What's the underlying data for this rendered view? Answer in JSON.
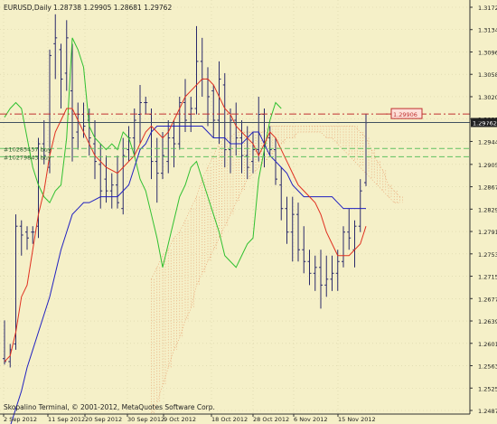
{
  "header": {
    "symbol_timeframe": "EURUSD,Daily",
    "ohlc": "1.28738 1.29905 1.28681 1.29762"
  },
  "footer": {
    "copyright": "Skopalino Terminal, © 2001-2012, MetaQuotes Software Corp."
  },
  "orders": [
    {
      "label": "#10285457 buy",
      "price": 1.2932
    },
    {
      "label": "#10279843 buy",
      "price": 1.2918
    }
  ],
  "price_scale": [
    "1.31720",
    "1.31340",
    "1.30960",
    "1.30580",
    "1.30200",
    "1.29820",
    "1.29440",
    "1.29050",
    "1.28670",
    "1.28290",
    "1.27910",
    "1.27530",
    "1.27150",
    "1.26770",
    "1.26390",
    "1.26010",
    "1.25630",
    "1.25250",
    "1.24870"
  ],
  "markers": {
    "alert_price": "1.29906",
    "current_price": "1.29762"
  },
  "date_labels": [
    "2 Sep 2012",
    "11 Sep 2012",
    "20 Sep 2012",
    "30 Sep 2012",
    "9 Oct 2012",
    "18 Oct 2012",
    "28 Oct 2012",
    "6 Nov 2012",
    "15 Nov 2012"
  ],
  "colors": {
    "background": "#f5f0c8",
    "bars": "#2a2a6a",
    "tenkan": "#e03020",
    "kijun": "#2020c0",
    "chikou": "#30c030",
    "cloud": "#e8a070",
    "order_line": "#60c060",
    "alert_line": "#c03030",
    "current_line": "#405060"
  },
  "chart_data": {
    "type": "ohlc",
    "title": "EURUSD,Daily",
    "ylim": [
      1.2487,
      1.3172
    ],
    "bars": [
      [
        1.2575,
        1.264,
        1.2565,
        1.257
      ],
      [
        1.257,
        1.26,
        1.256,
        1.259
      ],
      [
        1.26,
        1.282,
        1.259,
        1.28
      ],
      [
        1.28,
        1.281,
        1.275,
        1.2785
      ],
      [
        1.279,
        1.28,
        1.276,
        1.278
      ],
      [
        1.279,
        1.28,
        1.277,
        1.279
      ],
      [
        1.28,
        1.295,
        1.278,
        1.294
      ],
      [
        1.294,
        1.298,
        1.2905,
        1.292
      ],
      [
        1.29,
        1.31,
        1.289,
        1.309
      ],
      [
        1.311,
        1.316,
        1.305,
        1.312
      ],
      [
        1.31,
        1.311,
        1.3,
        1.305
      ],
      [
        1.306,
        1.315,
        1.303,
        1.312
      ],
      [
        1.303,
        1.311,
        1.291,
        1.295
      ],
      [
        1.296,
        1.301,
        1.293,
        1.299
      ],
      [
        1.299,
        1.301,
        1.295,
        1.297
      ],
      [
        1.298,
        1.3,
        1.292,
        1.295
      ],
      [
        1.294,
        1.298,
        1.288,
        1.291
      ],
      [
        1.2905,
        1.294,
        1.283,
        1.286
      ],
      [
        1.288,
        1.292,
        1.284,
        1.286
      ],
      [
        1.286,
        1.289,
        1.283,
        1.287
      ],
      [
        1.287,
        1.292,
        1.283,
        1.284
      ],
      [
        1.283,
        1.295,
        1.282,
        1.292
      ],
      [
        1.293,
        1.297,
        1.291,
        1.295
      ],
      [
        1.295,
        1.3,
        1.292,
        1.298
      ],
      [
        1.299,
        1.304,
        1.294,
        1.301
      ],
      [
        1.301,
        1.302,
        1.299,
        1.301
      ],
      [
        1.299,
        1.3,
        1.288,
        1.291
      ],
      [
        1.291,
        1.295,
        1.284,
        1.289
      ],
      [
        1.289,
        1.296,
        1.288,
        1.292
      ],
      [
        1.291,
        1.298,
        1.289,
        1.295
      ],
      [
        1.295,
        1.298,
        1.29,
        1.294
      ],
      [
        1.294,
        1.302,
        1.293,
        1.301
      ],
      [
        1.301,
        1.305,
        1.296,
        1.298
      ],
      [
        1.299,
        1.302,
        1.296,
        1.3
      ],
      [
        1.3,
        1.314,
        1.299,
        1.308
      ],
      [
        1.308,
        1.312,
        1.302,
        1.305
      ],
      [
        1.305,
        1.307,
        1.297,
        1.302
      ],
      [
        1.303,
        1.304,
        1.295,
        1.298
      ],
      [
        1.298,
        1.308,
        1.294,
        1.305
      ],
      [
        1.304,
        1.306,
        1.29,
        1.293
      ],
      [
        1.293,
        1.3,
        1.289,
        1.298
      ],
      [
        1.298,
        1.301,
        1.292,
        1.295
      ],
      [
        1.295,
        1.298,
        1.289,
        1.292
      ],
      [
        1.292,
        1.297,
        1.288,
        1.29
      ],
      [
        1.291,
        1.296,
        1.289,
        1.293
      ],
      [
        1.293,
        1.302,
        1.291,
        1.299
      ],
      [
        1.299,
        1.3,
        1.29,
        1.294
      ],
      [
        1.295,
        1.297,
        1.292,
        1.293
      ],
      [
        1.293,
        1.295,
        1.287,
        1.288
      ],
      [
        1.287,
        1.29,
        1.281,
        1.283
      ],
      [
        1.283,
        1.285,
        1.277,
        1.279
      ],
      [
        1.279,
        1.285,
        1.274,
        1.282
      ],
      [
        1.282,
        1.284,
        1.274,
        1.276
      ],
      [
        1.276,
        1.28,
        1.272,
        1.274
      ],
      [
        1.274,
        1.276,
        1.27,
        1.272
      ],
      [
        1.272,
        1.275,
        1.269,
        1.273
      ],
      [
        1.273,
        1.276,
        1.266,
        1.27
      ],
      [
        1.27,
        1.275,
        1.268,
        1.271
      ],
      [
        1.271,
        1.275,
        1.269,
        1.272
      ],
      [
        1.272,
        1.276,
        1.269,
        1.274
      ],
      [
        1.274,
        1.28,
        1.273,
        1.279
      ],
      [
        1.279,
        1.283,
        1.276,
        1.278
      ],
      [
        1.276,
        1.281,
        1.273,
        1.28
      ],
      [
        1.28,
        1.288,
        1.279,
        1.286
      ],
      [
        1.2874,
        1.2991,
        1.2868,
        1.2976
      ]
    ],
    "cloud_start_bar": 26,
    "senkou_a": [
      1.271,
      1.273,
      1.275,
      1.276,
      1.278,
      1.279,
      1.281,
      1.283,
      1.285,
      1.288,
      1.29,
      1.292,
      1.294,
      1.295,
      1.295,
      1.296,
      1.296,
      1.296,
      1.296,
      1.296,
      1.296,
      1.297,
      1.297,
      1.297,
      1.297,
      1.297,
      1.297,
      1.297,
      1.297,
      1.297,
      1.297,
      1.297,
      1.297,
      1.297,
      1.297,
      1.297,
      1.297,
      1.296,
      1.295,
      1.293,
      1.291,
      1.2895,
      1.287,
      1.286,
      1.285
    ],
    "senkou_b": [
      1.248,
      1.25,
      1.253,
      1.256,
      1.259,
      1.261,
      1.264,
      1.266,
      1.27,
      1.272,
      1.274,
      1.276,
      1.278,
      1.28,
      1.282,
      1.284,
      1.286,
      1.288,
      1.289,
      1.29,
      1.291,
      1.292,
      1.293,
      1.294,
      1.295,
      1.295,
      1.296,
      1.296,
      1.296,
      1.296,
      1.296,
      1.295,
      1.295,
      1.294,
      1.293,
      1.292,
      1.291,
      1.29,
      1.289,
      1.288,
      1.287,
      1.286,
      1.285,
      1.284,
      1.284
    ],
    "tenkan": [
      1.257,
      1.258,
      1.262,
      1.268,
      1.27,
      1.276,
      1.282,
      1.286,
      1.292,
      1.296,
      1.298,
      1.3,
      1.3,
      1.298,
      1.296,
      1.294,
      1.292,
      1.291,
      1.29,
      1.2895,
      1.289,
      1.29,
      1.291,
      1.292,
      1.294,
      1.296,
      1.297,
      1.296,
      1.295,
      1.296,
      1.298,
      1.3,
      1.302,
      1.303,
      1.304,
      1.305,
      1.305,
      1.304,
      1.302,
      1.3,
      1.299,
      1.297,
      1.296,
      1.295,
      1.294,
      1.292,
      1.294,
      1.296,
      1.295,
      1.293,
      1.291,
      1.289,
      1.287,
      1.286,
      1.285,
      1.284,
      1.282,
      1.279,
      1.277,
      1.275,
      1.275,
      1.275,
      1.276,
      1.277,
      1.28
    ],
    "kijun": [
      1.244,
      1.246,
      1.249,
      1.252,
      1.256,
      1.259,
      1.262,
      1.265,
      1.268,
      1.272,
      1.276,
      1.279,
      1.282,
      1.283,
      1.284,
      1.284,
      1.2845,
      1.285,
      1.285,
      1.285,
      1.285,
      1.286,
      1.287,
      1.29,
      1.293,
      1.294,
      1.296,
      1.297,
      1.297,
      1.297,
      1.297,
      1.297,
      1.297,
      1.297,
      1.297,
      1.297,
      1.296,
      1.295,
      1.295,
      1.295,
      1.294,
      1.294,
      1.294,
      1.295,
      1.296,
      1.296,
      1.294,
      1.292,
      1.291,
      1.29,
      1.289,
      1.287,
      1.286,
      1.285,
      1.285,
      1.285,
      1.285,
      1.285,
      1.285,
      1.284,
      1.283,
      1.283,
      1.283,
      1.283,
      1.283
    ],
    "chikou": [
      1.2985,
      1.3,
      1.301,
      1.3,
      1.295,
      1.29,
      1.287,
      1.285,
      1.284,
      1.286,
      1.287,
      1.295,
      1.312,
      1.31,
      1.307,
      1.297,
      1.295,
      1.294,
      1.293,
      1.294,
      1.293,
      1.296,
      1.295,
      1.292,
      1.288,
      1.286,
      1.282,
      1.278,
      1.273,
      1.277,
      1.281,
      1.285,
      1.287,
      1.29,
      1.291,
      1.288,
      1.285,
      1.282,
      1.279,
      1.275,
      1.274,
      1.273,
      1.275,
      1.277,
      1.278,
      1.288,
      1.293,
      1.298,
      1.301,
      1.3
    ]
  }
}
